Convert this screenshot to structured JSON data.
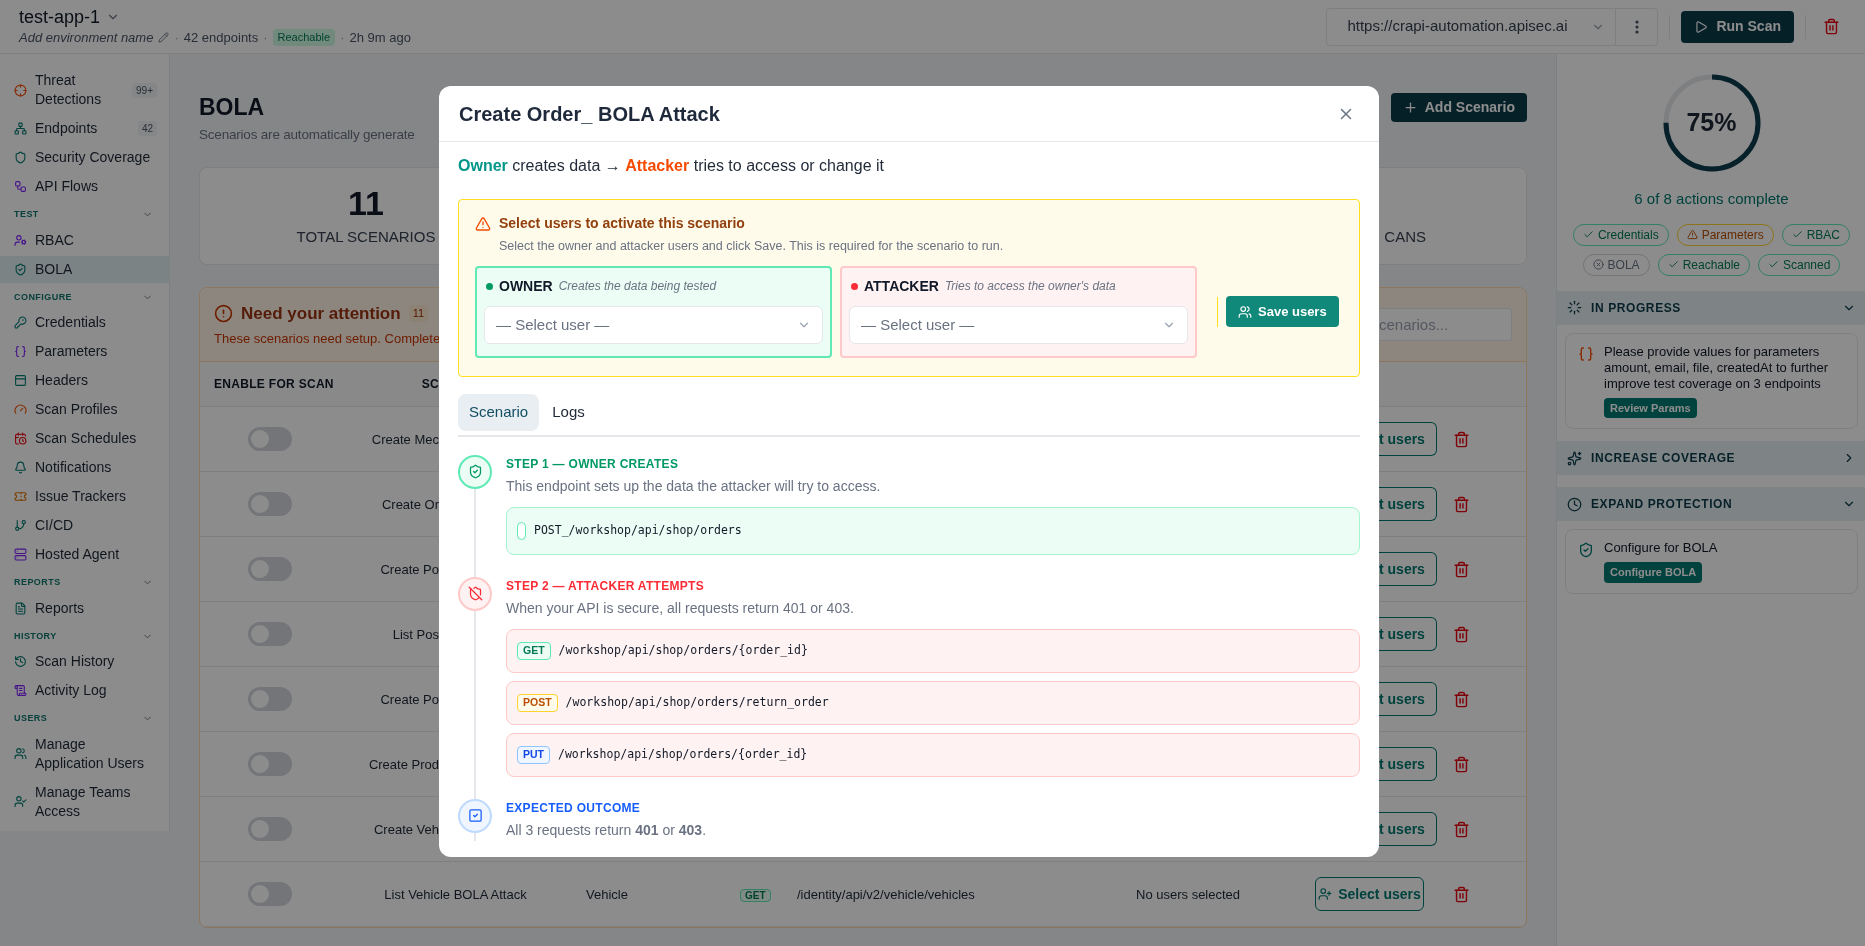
{
  "header": {
    "app_name": "test-app-1",
    "env_placeholder": "Add environment name",
    "meta": [
      {
        "kind": "text",
        "separator": "·",
        "text": "42 endpoints"
      },
      {
        "kind": "badge",
        "separator": "·",
        "text": "Reachable"
      },
      {
        "kind": "text",
        "separator": "·",
        "text": "2h 9m ago"
      }
    ],
    "url": "https://crapi-automation.apisec.ai",
    "run_button": "Run Scan"
  },
  "sidebar": {
    "top_items": [
      {
        "label": "Threat Detections",
        "badge": "99+",
        "selected": false
      },
      {
        "label": "Endpoints",
        "badge": "42",
        "selected": false
      },
      {
        "label": "Security Coverage",
        "selected": false
      },
      {
        "label": "API Flows",
        "selected": false
      }
    ],
    "groups": [
      {
        "title": "TEST",
        "expanded": true,
        "items": [
          {
            "label": "RBAC",
            "selected": false
          },
          {
            "label": "BOLA",
            "selected": true
          }
        ]
      },
      {
        "title": "CONFIGURE",
        "expanded": true,
        "items": [
          {
            "label": "Credentials",
            "selected": false
          },
          {
            "label": "Parameters",
            "selected": false
          },
          {
            "label": "Headers",
            "selected": false
          },
          {
            "label": "Scan Profiles",
            "selected": false
          },
          {
            "label": "Scan Schedules",
            "selected": false
          },
          {
            "label": "Notifications",
            "selected": false
          },
          {
            "label": "Issue Trackers",
            "selected": false
          },
          {
            "label": "CI/CD",
            "selected": false
          },
          {
            "label": "Hosted Agent",
            "selected": false
          }
        ]
      },
      {
        "title": "REPORTS",
        "expanded": true,
        "items": [
          {
            "label": "Reports",
            "selected": false
          }
        ]
      },
      {
        "title": "HISTORY",
        "expanded": true,
        "items": [
          {
            "label": "Scan History",
            "selected": false
          },
          {
            "label": "Activity Log",
            "selected": false
          }
        ]
      },
      {
        "title": "USERS",
        "expanded": true,
        "items": [
          {
            "label": "Manage Application Users",
            "selected": false
          },
          {
            "label": "Manage Teams Access",
            "selected": false
          }
        ]
      }
    ]
  },
  "page": {
    "title": "BOLA",
    "subtitle": "Scenarios are automatically generate",
    "add_button": "Add Scenario",
    "stats": [
      {
        "value": "11",
        "label": "TOTAL SCENARIOS"
      },
      {
        "label": "CANS"
      }
    ],
    "attention": {
      "title": "Need your attention",
      "count": "11",
      "text": "These scenarios need setup. Complete",
      "search_placeholder": "cenarios..."
    },
    "table": {
      "columns": [
        "ENABLE FOR SCAN",
        "SC"
      ],
      "rows": [
        {
          "kind": "clipped",
          "enabled": false,
          "name": "Create Mec",
          "action": "t users"
        },
        {
          "kind": "clipped",
          "enabled": false,
          "name": "Create Or",
          "action": "t users"
        },
        {
          "kind": "clipped",
          "enabled": false,
          "name": "Create Po",
          "action": "t users"
        },
        {
          "kind": "clipped",
          "enabled": false,
          "name": "List Pos",
          "action": "t users"
        },
        {
          "kind": "clipped",
          "enabled": false,
          "name": "Create Po",
          "action": "t users"
        },
        {
          "kind": "clipped",
          "enabled": false,
          "name": "Create Prod",
          "action": "t users"
        },
        {
          "kind": "clipped",
          "enabled": false,
          "name": "Create Veh",
          "action": "t users"
        },
        {
          "kind": "full",
          "enabled": false,
          "name": "List Vehicle BOLA Attack",
          "category": "Vehicle",
          "method": "GET",
          "path": "/identity/api/v2/vehicle/vehicles",
          "status": "No users selected",
          "action": "Select users"
        }
      ]
    }
  },
  "right_panel": {
    "progress": {
      "level": 0.75,
      "percent": "75%",
      "caption": "6 of 8 actions complete"
    },
    "checks": [
      {
        "label": "Credentials",
        "kind": "done"
      },
      {
        "label": "Parameters",
        "kind": "warning"
      },
      {
        "label": "RBAC",
        "kind": "done"
      },
      {
        "label": "BOLA",
        "kind": "failed"
      },
      {
        "label": "Reachable",
        "kind": "done"
      },
      {
        "label": "Scanned",
        "kind": "done"
      }
    ],
    "sections": [
      {
        "title": "IN PROGRESS",
        "expanded": true,
        "cards": [
          {
            "text": "Please provide values for parameters amount, email, file, createdAt to further improve test coverage on 3 endpoints",
            "button": "Review Params"
          }
        ]
      },
      {
        "title": "INCREASE COVERAGE",
        "expanded": false
      },
      {
        "title": "EXPAND PROTECTION",
        "expanded": true,
        "cards": [
          {
            "text": "Configure for BOLA",
            "button": "Configure BOLA"
          }
        ]
      }
    ]
  },
  "modal": {
    "title": "Create Order_ BOLA Attack",
    "flow": {
      "owner": "Owner",
      "middle": "creates data →",
      "attacker": "Attacker",
      "end": "tries to access or change it"
    },
    "notice": {
      "title": "Select users to activate this scenario",
      "text": "Select the owner and attacker users and click Save. This is required for the scenario to run.",
      "roles": [
        {
          "kind": "owner",
          "label": "OWNER",
          "hint": "Creates the data being tested",
          "placeholder": "— Select user —"
        },
        {
          "kind": "attacker",
          "label": "ATTACKER",
          "hint": "Tries to access the owner's data",
          "placeholder": "— Select user —"
        }
      ],
      "save_button": "Save users"
    },
    "tabs": [
      {
        "label": "Scenario",
        "selected": true
      },
      {
        "label": "Logs",
        "selected": false
      }
    ],
    "steps": [
      {
        "kind": "owner",
        "title": "STEP 1 — OWNER CREATES",
        "description": "This endpoint sets up the data the attacker will try to access.",
        "requests": [
          {
            "kind": "blank",
            "path": "POST_/workshop/api/shop/orders"
          }
        ]
      },
      {
        "kind": "attacker",
        "title": "STEP 2 — ATTACKER ATTEMPTS",
        "description": "When your API is secure, all requests return 401 or 403.",
        "requests": [
          {
            "kind": "get",
            "method": "GET",
            "path": "/workshop/api/shop/orders/{order_id}"
          },
          {
            "kind": "post",
            "method": "POST",
            "path": "/workshop/api/shop/orders/return_order"
          },
          {
            "kind": "put",
            "method": "PUT",
            "path": "/workshop/api/shop/orders/{order_id}"
          }
        ]
      },
      {
        "kind": "outcome",
        "title": "EXPECTED OUTCOME",
        "description": "All 3 requests return **401** or **403**."
      }
    ]
  }
}
